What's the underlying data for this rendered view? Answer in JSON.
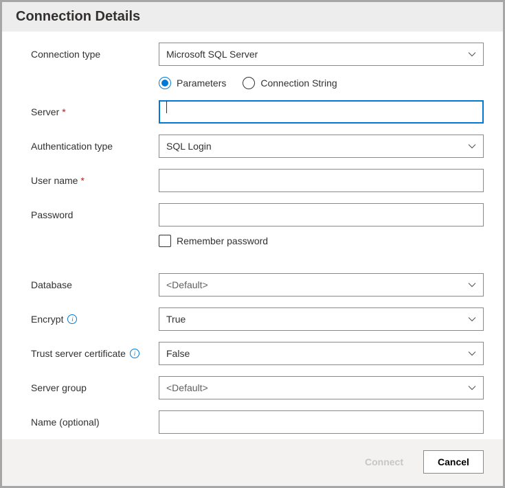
{
  "header": {
    "title": "Connection Details"
  },
  "labels": {
    "connection_type": "Connection type",
    "server": "Server",
    "auth_type": "Authentication type",
    "user_name": "User name",
    "password": "Password",
    "remember_password": "Remember password",
    "database": "Database",
    "encrypt": "Encrypt",
    "trust_cert": "Trust server certificate",
    "server_group": "Server group",
    "name_optional": "Name (optional)"
  },
  "radios": {
    "parameters": "Parameters",
    "connection_string": "Connection String"
  },
  "values": {
    "connection_type": "Microsoft SQL Server",
    "auth_type": "SQL Login",
    "database": "<Default>",
    "encrypt": "True",
    "trust_cert": "False",
    "server_group": "<Default>",
    "server": "",
    "user_name": "",
    "password": "",
    "name_optional": ""
  },
  "footer": {
    "connect": "Connect",
    "cancel": "Cancel"
  }
}
